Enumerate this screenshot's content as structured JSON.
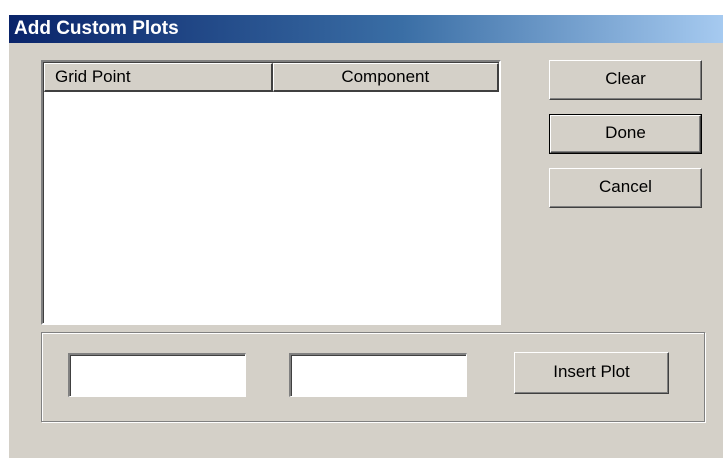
{
  "window": {
    "title": "Add Custom Plots"
  },
  "list": {
    "columns": [
      {
        "label": "Grid Point"
      },
      {
        "label": "Component"
      }
    ],
    "rows": []
  },
  "buttons": {
    "clear_label": "Clear",
    "done_label": "Done",
    "cancel_label": "Cancel",
    "insert_plot_label": "Insert Plot"
  },
  "inputs": {
    "grid_point_value": "",
    "component_value": ""
  },
  "colors": {
    "window_bg": "#d4d0c8",
    "title_gradient_start": "#0a246a",
    "title_gradient_end": "#a6caf0",
    "title_text": "#ffffff",
    "list_bg": "#ffffff"
  }
}
